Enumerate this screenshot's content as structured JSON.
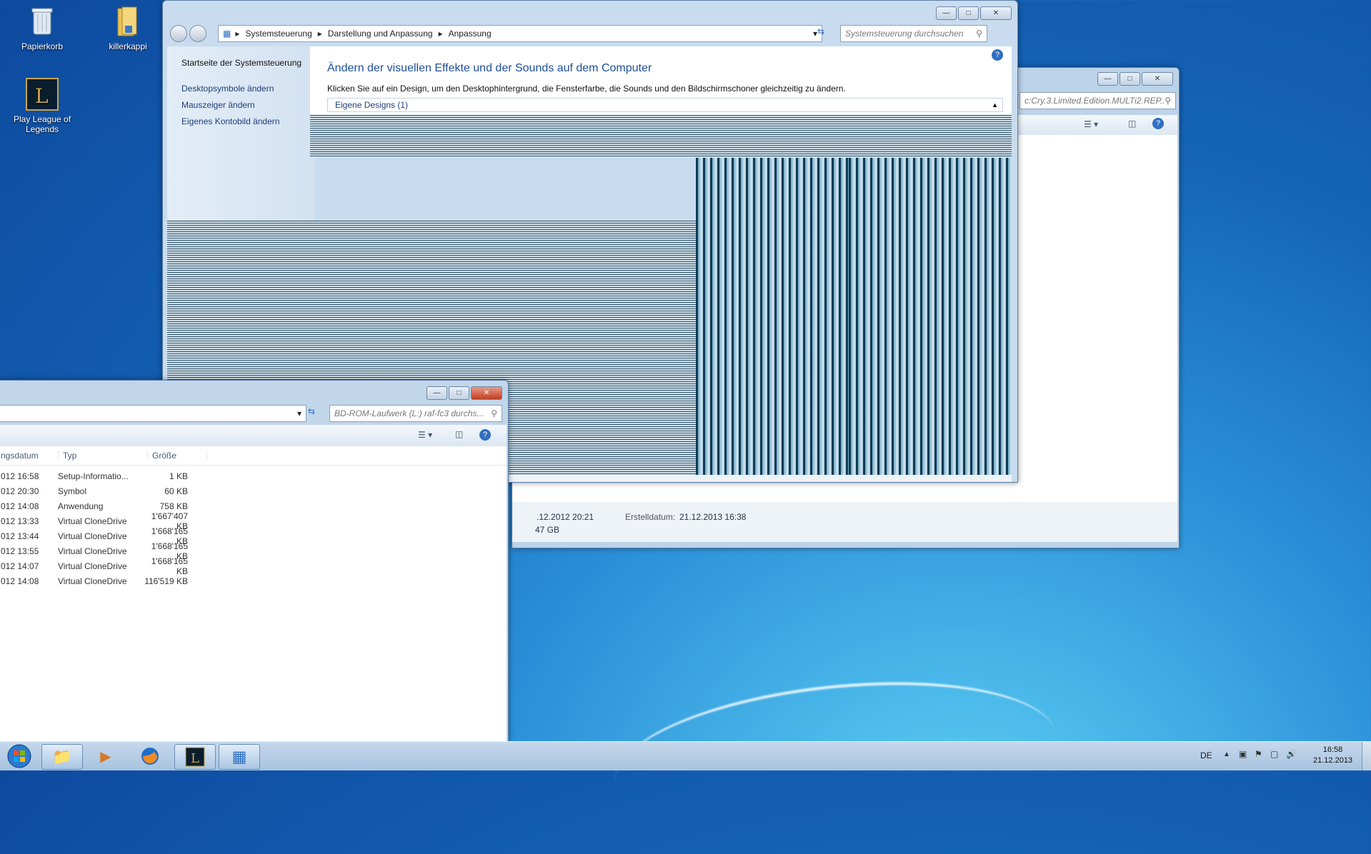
{
  "desktop": {
    "icons": [
      {
        "label": "Papierkorb",
        "icon": "recycle-bin-icon"
      },
      {
        "label": "killerkappi",
        "icon": "folder-icon"
      },
      {
        "label": "Play League of Legends",
        "icon": "league-of-legends-icon"
      }
    ]
  },
  "control_panel": {
    "breadcrumb": [
      "Systemsteuerung",
      "Darstellung und Anpassung",
      "Anpassung"
    ],
    "search_placeholder": "Systemsteuerung durchsuchen",
    "sidebar_links": [
      "Startseite der Systemsteuerung",
      "Desktopsymbole ändern",
      "Mauszeiger ändern",
      "Eigenes Kontobild ändern"
    ],
    "heading": "Ändern der visuellen Effekte und der Sounds auf dem Computer",
    "description": "Klicken Sie auf ein Design, um den Desktophintergrund, die Fensterfarbe, die Sounds und den Bildschirmschoner gleichzeitig zu ändern.",
    "group_label": "Eigene Designs (1)"
  },
  "explorer_back": {
    "search_placeholder": "c:Cry.3.Limited.Edition.MULTi2.REP...",
    "details": {
      "modified_partial": ".12.2012 20:21",
      "size_partial": "47 GB",
      "created_label": "Erstelldatum:",
      "created_value": "21.12.2013 16:38"
    }
  },
  "explorer_front": {
    "search_placeholder": "BD-ROM-Laufwerk (L:) raf-fc3 durchs...",
    "columns": [
      "ngsdatum",
      "Typ",
      "Größe"
    ],
    "rows": [
      [
        "012 16:58",
        "Setup-Informatio...",
        "1 KB"
      ],
      [
        "012 20:30",
        "Symbol",
        "60 KB"
      ],
      [
        "012 14:08",
        "Anwendung",
        "758 KB"
      ],
      [
        "012 13:33",
        "Virtual CloneDrive",
        "1'667'407 KB"
      ],
      [
        "012 13:44",
        "Virtual CloneDrive",
        "1'668'165 KB"
      ],
      [
        "012 13:55",
        "Virtual CloneDrive",
        "1'668'165 KB"
      ],
      [
        "012 14:07",
        "Virtual CloneDrive",
        "1'668'165 KB"
      ],
      [
        "012 14:08",
        "Virtual CloneDrive",
        "116'519 KB"
      ]
    ]
  },
  "taskbar": {
    "buttons": [
      "start-orb-icon",
      "explorer-icon",
      "media-player-icon",
      "firefox-icon",
      "league-of-legends-icon",
      "control-panel-icon"
    ],
    "language": "DE",
    "time": "16:58",
    "date": "21.12.2013"
  }
}
